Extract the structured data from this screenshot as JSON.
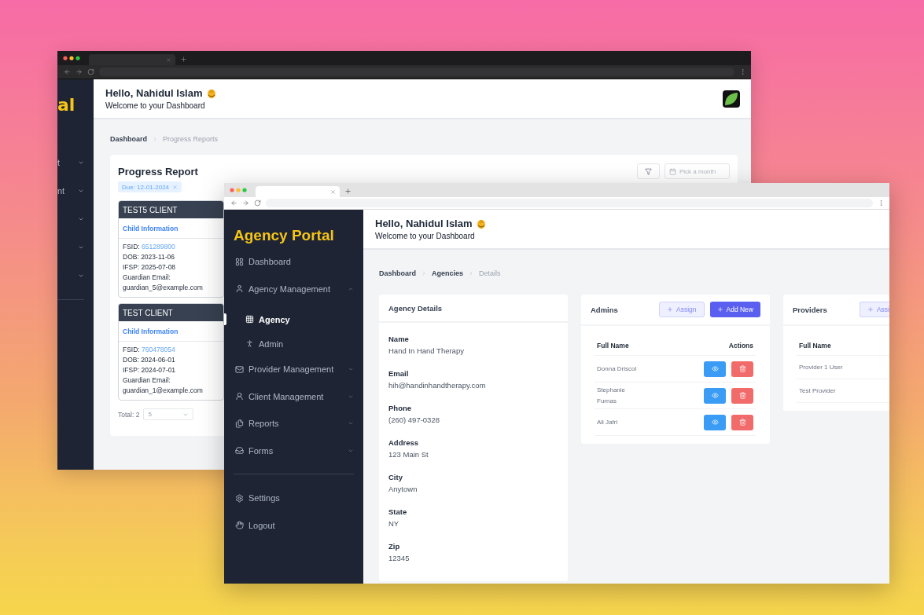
{
  "back_window": {
    "sidebar": {
      "logo_fragment": "al",
      "items": [
        {
          "label": "t",
          "expanded": false
        },
        {
          "label": "nt",
          "expanded": false
        },
        {
          "expanded": false
        },
        {
          "expanded": false
        },
        {
          "expanded": false
        }
      ]
    },
    "header": {
      "greeting": "Hello, Nahidul Islam",
      "subtitle": "Welcome to your Dashboard"
    },
    "breadcrumb": [
      {
        "label": "Dashboard",
        "current": false
      },
      {
        "label": "Progress Reports",
        "current": true
      }
    ],
    "report": {
      "title": "Progress Report",
      "filter_tag": "Due: 12-01-2024",
      "month_picker": {
        "placeholder": "Pick a month"
      },
      "clients": [
        {
          "name": "TEST5 CLIENT",
          "section": "Child Information",
          "fsid_label": "FSID:",
          "fsid": "651289800",
          "lines": [
            "DOB: 2023-11-06",
            "IFSP: 2025-07-08",
            "Guardian Email:",
            "guardian_5@example.com"
          ]
        },
        {
          "name": "TEST CLIENT",
          "section": "Child Information",
          "fsid_label": "FSID:",
          "fsid": "760478054",
          "lines": [
            "DOB: 2024-06-01",
            "IFSP: 2024-07-01",
            "Guardian Email:",
            "guardian_1@example.com"
          ]
        }
      ],
      "total": "Total: 2",
      "page_size": "5"
    }
  },
  "front_window": {
    "sidebar": {
      "logo": "Agency Portal",
      "items": [
        {
          "label": "Dashboard",
          "selected": false
        },
        {
          "label": "Agency Management",
          "selected": false,
          "expanded": true,
          "children": [
            {
              "label": "Agency",
              "selected": true
            },
            {
              "label": "Admin",
              "selected": false
            }
          ]
        },
        {
          "label": "Provider Management",
          "selected": false,
          "expanded": false
        },
        {
          "label": "Client Management",
          "selected": false,
          "expanded": false
        },
        {
          "label": "Reports",
          "selected": false,
          "expanded": false
        },
        {
          "label": "Forms",
          "selected": false,
          "expanded": false
        }
      ],
      "footer_items": [
        {
          "label": "Settings",
          "selected": false
        },
        {
          "label": "Logout",
          "selected": false
        }
      ]
    },
    "header": {
      "greeting": "Hello, Nahidul Islam",
      "subtitle": "Welcome to your Dashboard"
    },
    "breadcrumb": [
      {
        "label": "Dashboard",
        "current": false
      },
      {
        "label": "Agencies",
        "current": false
      },
      {
        "label": "Details",
        "current": true
      }
    ],
    "agency_details": {
      "title": "Agency Details",
      "fields": [
        {
          "label": "Name",
          "value": "Hand In Hand Therapy"
        },
        {
          "label": "Email",
          "value": "hih@handinhandtherapy.com"
        },
        {
          "label": "Phone",
          "value": "(260) 497-0328"
        },
        {
          "label": "Address",
          "value": "123 Main St"
        },
        {
          "label": "City",
          "value": "Anytown"
        },
        {
          "label": "State",
          "value": "NY"
        },
        {
          "label": "Zip",
          "value": "12345"
        }
      ]
    },
    "admins": {
      "title": "Admins",
      "assign_button": "Assign",
      "add_button": "Add New",
      "columns": [
        "Full Name",
        "Actions"
      ],
      "rows": [
        {
          "name": "Donna Driscol"
        },
        {
          "name": "Stephanie Furnas"
        },
        {
          "name": "Ali Jafri"
        }
      ]
    },
    "providers": {
      "title": "Providers",
      "assign_button": "Assi",
      "columns": [
        "Full Name"
      ],
      "rows": [
        {
          "name": "Provider 1 User"
        },
        {
          "name": "Test Provider"
        }
      ]
    }
  }
}
